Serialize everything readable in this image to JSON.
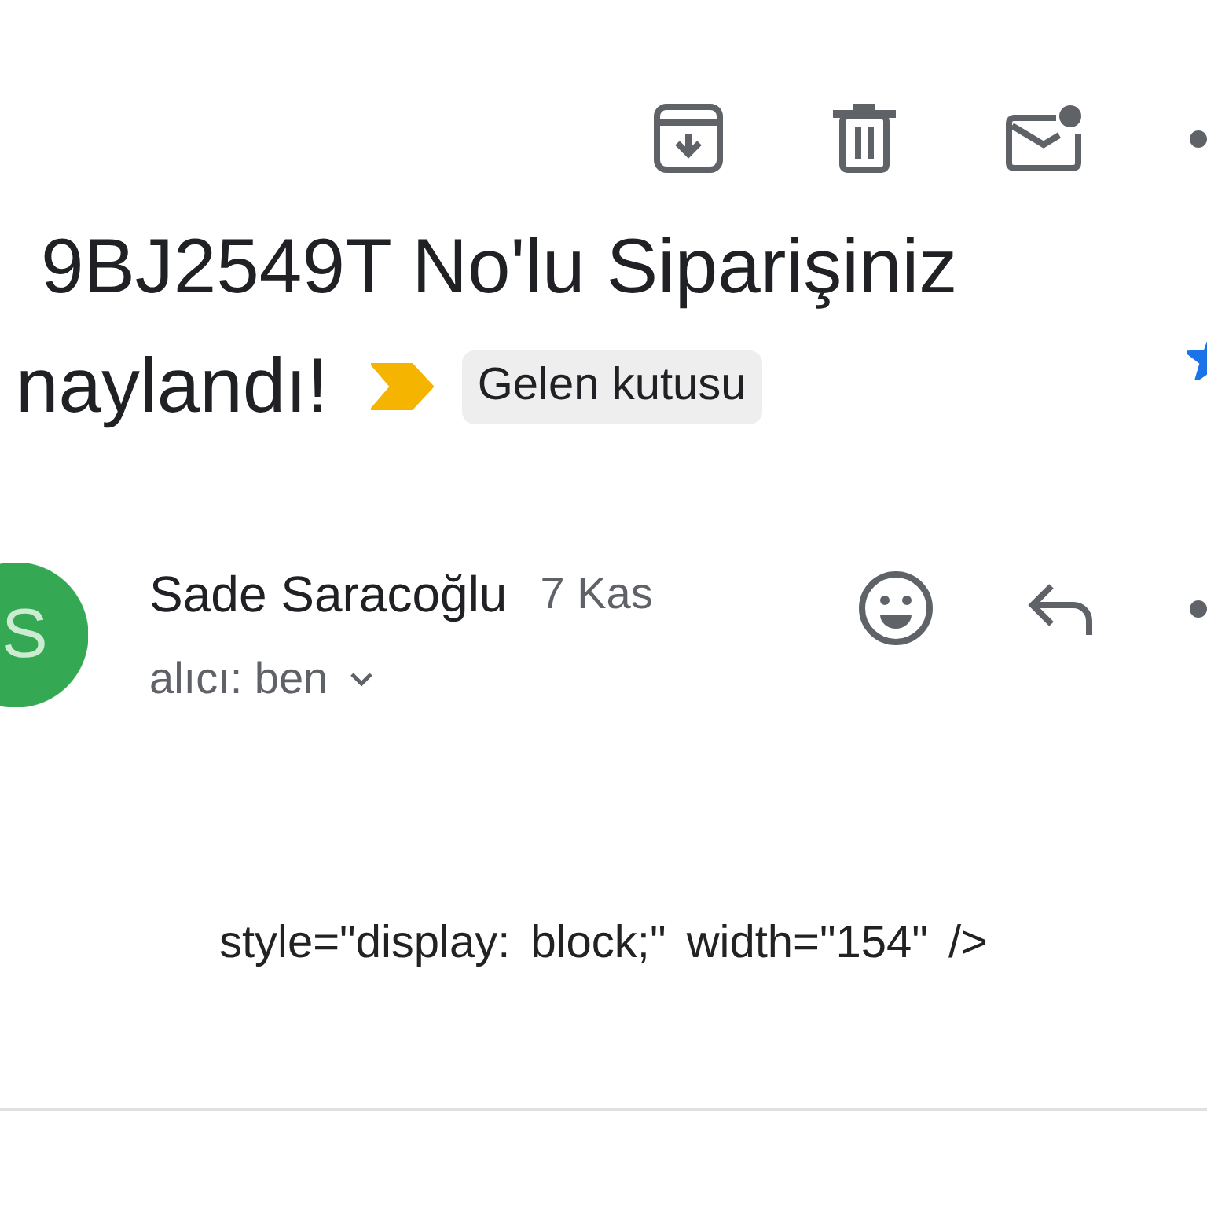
{
  "subject": {
    "lines": [
      "9BJ2549T No'lu Siparişiniz",
      "naylandı!"
    ],
    "important": true,
    "label": "Gelen kutusu",
    "starred": true
  },
  "message": {
    "avatar_letter": "S",
    "sender": "Sade Saracoğlu",
    "date": "7 Kas",
    "recipient": "alıcı: ben"
  },
  "body": {
    "text": "style=\"display: block;\" width=\"154\" />"
  }
}
